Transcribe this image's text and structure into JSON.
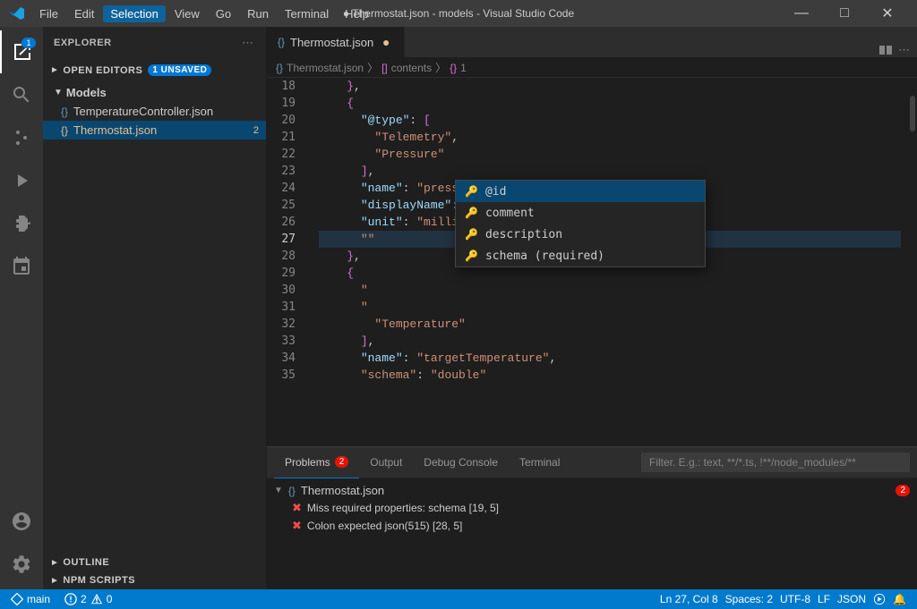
{
  "titlebar": {
    "title": "● Thermostat.json - models - Visual Studio Code",
    "menu": [
      "File",
      "Edit",
      "Selection",
      "View",
      "Go",
      "Run",
      "Terminal",
      "Help"
    ]
  },
  "sidebar": {
    "header": "Explorer",
    "open_editors": {
      "label": "Open Editors",
      "badge": "1 Unsaved"
    },
    "models_section": {
      "label": "Models",
      "files": [
        {
          "name": "TemperatureController.json",
          "modified": false,
          "badge": ""
        },
        {
          "name": "Thermostat.json",
          "modified": true,
          "badge": "2"
        }
      ]
    },
    "outline": "Outline",
    "npm_scripts": "NPM Scripts"
  },
  "tabs": [
    {
      "label": "Thermostat.json",
      "modified": true,
      "active": true
    }
  ],
  "breadcrumb": [
    {
      "icon": "{}",
      "label": "Thermostat.json"
    },
    {
      "icon": "[]",
      "label": "contents"
    },
    {
      "icon": "{}",
      "label": "1"
    }
  ],
  "code_lines": [
    {
      "num": "18",
      "content": "    },"
    },
    {
      "num": "19",
      "content": "    {"
    },
    {
      "num": "20",
      "content": "      \"@type\": ["
    },
    {
      "num": "21",
      "content": "        \"Telemetry\","
    },
    {
      "num": "22",
      "content": "        \"Pressure\""
    },
    {
      "num": "23",
      "content": "      ],"
    },
    {
      "num": "24",
      "content": "      \"name\": \"pressure\","
    },
    {
      "num": "25",
      "content": "      \"displayName\": \"Pressure\","
    },
    {
      "num": "26",
      "content": "      \"unit\": \"millibar\","
    },
    {
      "num": "27",
      "content": "      \"\""
    },
    {
      "num": "28",
      "content": "    },"
    },
    {
      "num": "29",
      "content": "    {"
    },
    {
      "num": "30",
      "content": "      \""
    },
    {
      "num": "31",
      "content": "      \""
    },
    {
      "num": "32",
      "content": "        \"Temperature\""
    },
    {
      "num": "33",
      "content": "      ],"
    },
    {
      "num": "34",
      "content": "      \"name\": \"targetTemperature\","
    },
    {
      "num": "35",
      "content": "      \"schema\": \"double\""
    }
  ],
  "autocomplete": {
    "items": [
      {
        "label": "@id",
        "selected": true
      },
      {
        "label": "comment"
      },
      {
        "label": "description"
      },
      {
        "label": "schema (required)"
      }
    ]
  },
  "panel": {
    "tabs": [
      {
        "label": "Problems",
        "badge": "2",
        "active": true
      },
      {
        "label": "Output",
        "badge": ""
      },
      {
        "label": "Debug Console",
        "badge": ""
      },
      {
        "label": "Terminal",
        "badge": ""
      }
    ],
    "filter_placeholder": "Filter. E.g.: text, **/*.ts, !**/node_modules/**",
    "problems": {
      "file": "Thermostat.json",
      "count": 2,
      "items": [
        {
          "text": "Miss required properties: schema [19, 5]"
        },
        {
          "text": "Colon expected  json(515) [28, 5]"
        }
      ]
    }
  },
  "statusbar": {
    "errors": "2",
    "warnings": "0",
    "position": "Ln 27, Col 8",
    "spaces": "Spaces: 2",
    "encoding": "UTF-8",
    "eol": "LF",
    "language": "JSON",
    "feedback_icon": "🔔"
  }
}
